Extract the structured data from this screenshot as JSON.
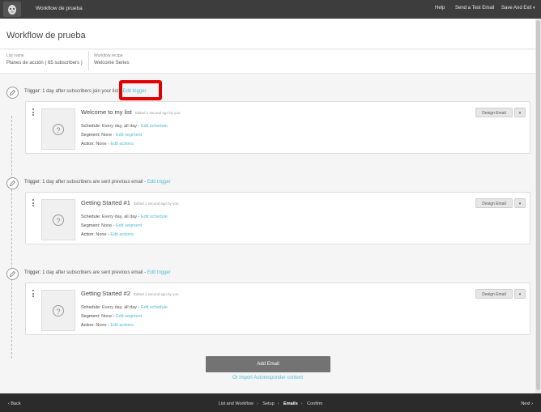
{
  "topbar": {
    "app_title": "Workflow de prueba",
    "help": "Help",
    "send_test": "Send a Test Email",
    "save_exit": "Save And Exit",
    "caret": "▾"
  },
  "page": {
    "title": "Workflow de prueba",
    "list_label": "List name",
    "list_value": "Planes de acción ( 65 subscribers )",
    "recipe_label": "Workflow recipe",
    "recipe_value": "Welcome Series"
  },
  "triggers": [
    {
      "label": "Trigger:",
      "text": "1 day after subscribers join your list",
      "sep": " - ",
      "link": "Edit trigger"
    },
    {
      "label": "Trigger:",
      "text": "1 day after subscribers are sent previous email",
      "sep": " - ",
      "link": "Edit trigger"
    },
    {
      "label": "Trigger:",
      "text": "1 day after subscribers are sent previous email",
      "sep": " - ",
      "link": "Edit trigger"
    }
  ],
  "emails": [
    {
      "name": "Welcome to my list",
      "meta": "Edited 1 second ago by you.",
      "schedule_label": "Schedule:",
      "schedule_value": "Every day, all day",
      "schedule_link": "Edit schedule",
      "segment_label": "Segment:",
      "segment_value": "None",
      "segment_link": "Edit segment",
      "action_label": "Action:",
      "action_value": "None",
      "action_link": "Edit actions",
      "design_label": "Design Email",
      "dd": "▾",
      "sep": " - "
    },
    {
      "name": "Getting Started #1",
      "meta": "Edited 1 second ago by you.",
      "schedule_label": "Schedule:",
      "schedule_value": "Every day, all day",
      "schedule_link": "Edit schedule",
      "segment_label": "Segment:",
      "segment_value": "None",
      "segment_link": "Edit segment",
      "action_label": "Action:",
      "action_value": "None",
      "action_link": "Edit actions",
      "design_label": "Design Email",
      "dd": "▾",
      "sep": " - "
    },
    {
      "name": "Getting Started #2",
      "meta": "Edited 1 second ago by you.",
      "schedule_label": "Schedule:",
      "schedule_value": "Every day, all day",
      "schedule_link": "Edit schedule",
      "segment_label": "Segment:",
      "segment_value": "None",
      "segment_link": "Edit segment",
      "action_label": "Action:",
      "action_value": "None",
      "action_link": "Edit actions",
      "design_label": "Design Email",
      "dd": "▾",
      "sep": " - "
    }
  ],
  "add_email": "Add Email",
  "import_link": "Or import Autoresponder content",
  "footer": {
    "back": "‹ Back",
    "next": "Next ›",
    "steps": [
      "List and Workflow",
      "Setup",
      "Emails",
      "Confirm"
    ],
    "active_step": "Emails",
    "step_sep": "›"
  },
  "colors": {
    "accent": "#52bad5",
    "highlight": "#e30000",
    "topbar": "#3d3d3d",
    "footer": "#2b2b2b"
  }
}
